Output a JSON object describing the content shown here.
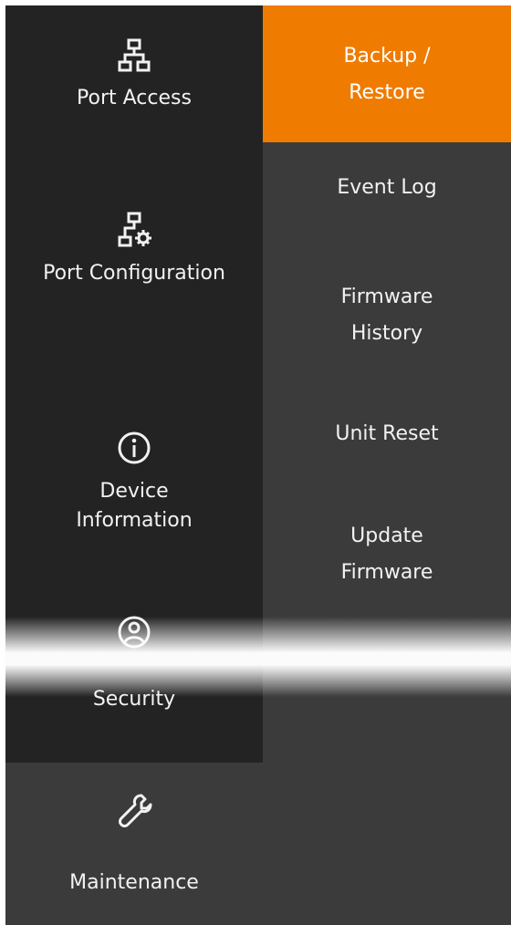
{
  "left_nav": {
    "items": [
      {
        "label": "Port Access",
        "icon": "network-icon"
      },
      {
        "label": "Port Configuration",
        "icon": "network-gear-icon"
      },
      {
        "label": "Device Information",
        "icon": "info-icon"
      },
      {
        "label": "Security",
        "icon": "user-circle-icon"
      },
      {
        "label": "Maintenance",
        "icon": "wrench-icon"
      }
    ],
    "active_index": 4
  },
  "sub_nav": {
    "items": [
      {
        "label": "Backup / Restore"
      },
      {
        "label": "Event Log"
      },
      {
        "label": "Firmware History"
      },
      {
        "label": "Unit Reset"
      },
      {
        "label": "Update Firmware"
      }
    ],
    "active_index": 0
  },
  "colors": {
    "nav_bg": "#232323",
    "sub_bg": "#3b3b3b",
    "accent": "#ef7b00",
    "text": "#f2f2f2"
  }
}
